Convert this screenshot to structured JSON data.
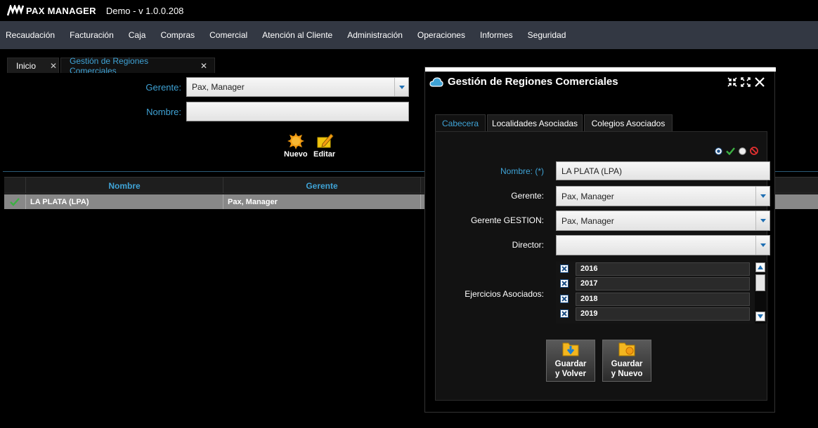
{
  "app": {
    "logo_text": "PAX MANAGER",
    "version": "Demo - v 1.0.0.208"
  },
  "menu": [
    "Recaudación",
    "Facturación",
    "Caja",
    "Compras",
    "Comercial",
    "Atención al Cliente",
    "Administración",
    "Operaciones",
    "Informes",
    "Seguridad"
  ],
  "tabs": [
    {
      "label": "Inicio",
      "close": "✕"
    },
    {
      "label": "Gestión de Regiones Comerciales",
      "close": "✕"
    }
  ],
  "filter": {
    "gerente_label": "Gerente:",
    "gerente_value": "Pax, Manager",
    "nombre_label": "Nombre:",
    "nombre_value": ""
  },
  "toolbar": {
    "nuevo": "Nuevo",
    "editar": "Editar"
  },
  "grid": {
    "columns": [
      "Nombre",
      "Gerente"
    ],
    "rows": [
      {
        "nombre": "LA PLATA (LPA)",
        "gerente": "Pax, Manager"
      }
    ]
  },
  "dialog": {
    "title": "Gestión de Regiones Comerciales",
    "tabs": [
      "Cabecera",
      "Localidades Asociadas",
      "Colegios Asociados"
    ],
    "fields": {
      "nombre_label": "Nombre: (*)",
      "nombre_value": "LA PLATA (LPA)",
      "gerente_label": "Gerente:",
      "gerente_value": "Pax, Manager",
      "gerente_gestion_label": "Gerente GESTION:",
      "gerente_gestion_value": "Pax, Manager",
      "director_label": "Director:",
      "director_value": "",
      "ejercicios_label": "Ejercicios Asociados:"
    },
    "ejercicios": [
      "2016",
      "2017",
      "2018",
      "2019"
    ],
    "buttons": {
      "guardar_volver": "Guardar\ny Volver",
      "guardar_nuevo": "Guardar\ny Nuevo"
    }
  },
  "colors": {
    "accent": "#3fa3d6",
    "menubar": "#333843"
  }
}
